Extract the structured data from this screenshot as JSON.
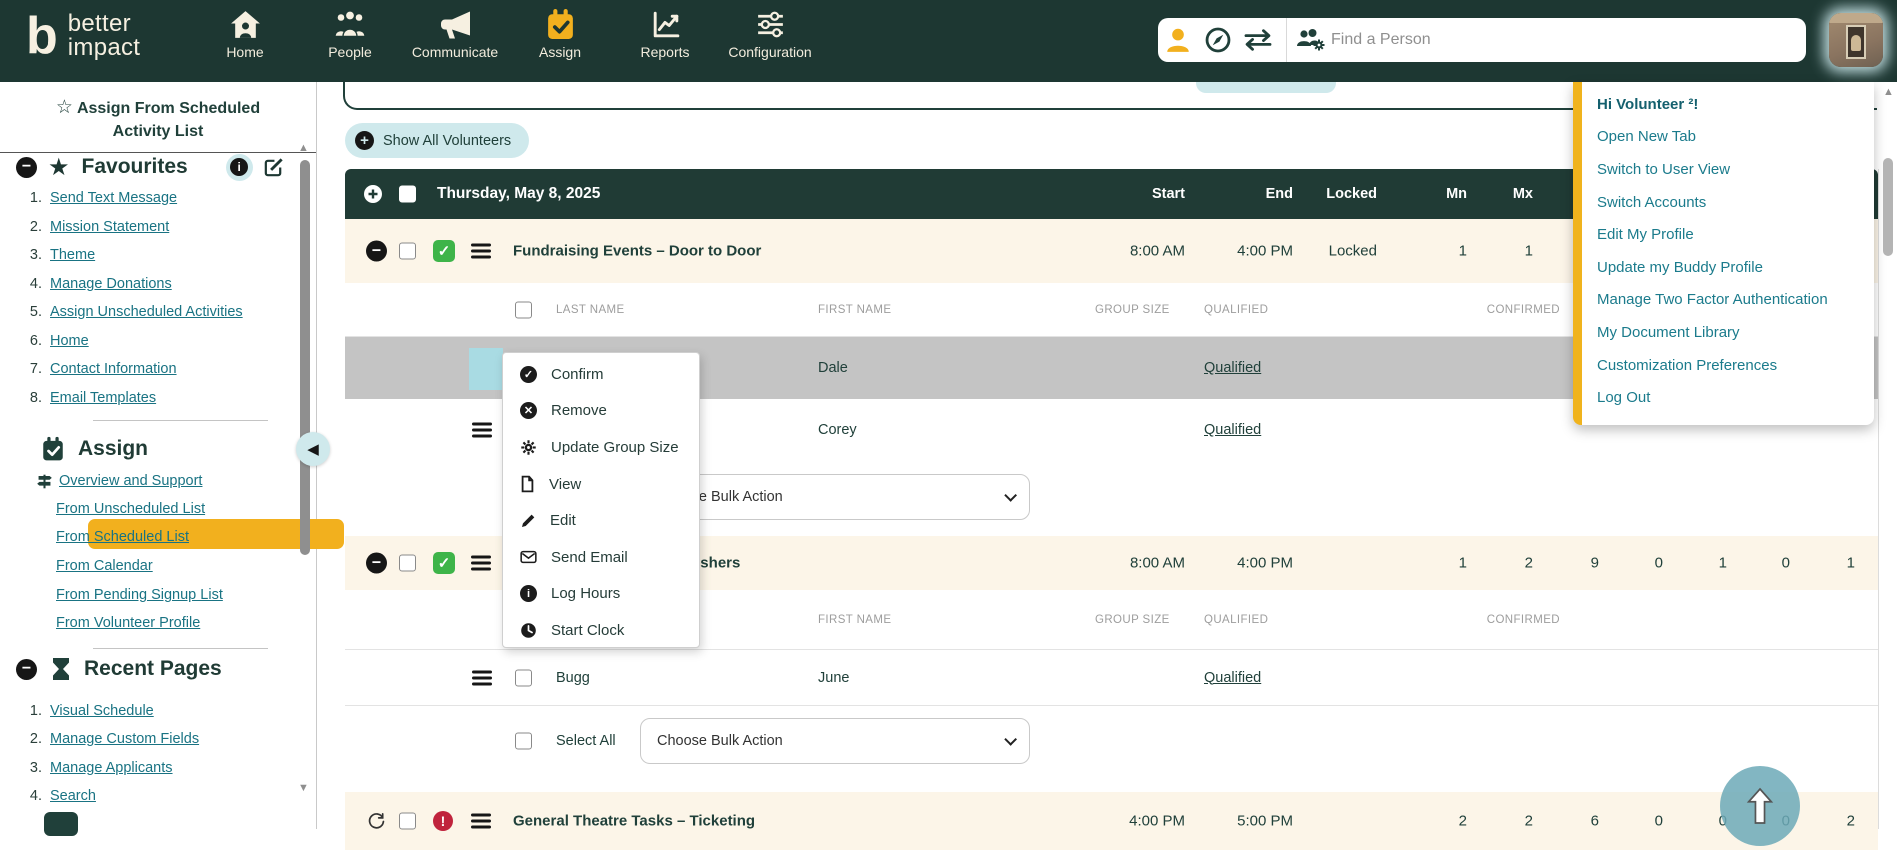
{
  "colors": {
    "nav_bg": "#1d3732",
    "accent_yellow": "#f2b01e",
    "light_teal": "#cfe9ec",
    "link_teal": "#197383",
    "menu_teal": "#1b7b8c",
    "dark_text": "#20403a",
    "row_cream": "#fcf5e8",
    "row_selected_gray": "#c4c4c4",
    "error_red": "#c0233c",
    "success_green": "#3eb449"
  },
  "nav": {
    "items": [
      "Home",
      "People",
      "Communicate",
      "Assign",
      "Reports",
      "Configuration"
    ],
    "active": "Assign",
    "search_placeholder": "Find a Person"
  },
  "user_menu": {
    "greeting": "Hi Volunteer ²!",
    "items": [
      "Open New Tab",
      "Switch to User View",
      "Switch Accounts",
      "Edit My Profile",
      "Update my Buddy Profile",
      "Manage Two Factor Authentication",
      "My Document Library",
      "Customization Preferences",
      "Log Out"
    ]
  },
  "sidebar": {
    "title": "Assign From Scheduled Activity List",
    "favourites": {
      "title": "Favourites",
      "items": [
        {
          "num": "1.",
          "label": "Send Text Message"
        },
        {
          "num": "2.",
          "label": "Mission Statement"
        },
        {
          "num": "3.",
          "label": "Theme"
        },
        {
          "num": "4.",
          "label": "Manage Donations"
        },
        {
          "num": "5.",
          "label": "Assign Unscheduled Activities"
        },
        {
          "num": "6.",
          "label": "Home"
        },
        {
          "num": "7.",
          "label": "Contact Information"
        },
        {
          "num": "8.",
          "label": "Email Templates"
        }
      ]
    },
    "assign": {
      "title": "Assign",
      "links": [
        "Overview and Support",
        "From Unscheduled List",
        "From Scheduled List",
        "From Calendar",
        "From Pending Signup List",
        "From Volunteer Profile"
      ],
      "active": "From Scheduled List"
    },
    "recent": {
      "title": "Recent Pages",
      "items": [
        {
          "num": "1.",
          "label": "Visual Schedule"
        },
        {
          "num": "2.",
          "label": "Manage Custom Fields"
        },
        {
          "num": "3.",
          "label": "Manage Applicants"
        },
        {
          "num": "4.",
          "label": "Search"
        }
      ]
    }
  },
  "main": {
    "show_all_label": "Show All Volunteers",
    "table": {
      "date_title": "Thursday, May 8, 2025",
      "columns": [
        "Start",
        "End",
        "Locked",
        "Mn",
        "Mx"
      ],
      "subcolumns": [
        "LAST NAME",
        "FIRST NAME",
        "GROUP SIZE",
        "QUALIFIED",
        "CONFIRMED"
      ],
      "activities": [
        {
          "name": "Fundraising Events – Door to Door",
          "start": "8:00 AM",
          "end": "4:00 PM",
          "locked": "Locked",
          "mn": "1",
          "mx": "1"
        },
        {
          "name": "General Theatre Tasks – Ushers",
          "start": "8:00 AM",
          "end": "4:00 PM",
          "counts": [
            "1",
            "2",
            "9",
            "0",
            "1",
            "0",
            "1"
          ]
        },
        {
          "name": "General Theatre Tasks – Ticketing",
          "start": "4:00 PM",
          "end": "5:00 PM",
          "counts": [
            "2",
            "2",
            "6",
            "0",
            "0",
            "0",
            "2"
          ]
        }
      ],
      "volunteers": [
        {
          "first": "Dale",
          "qualified": "Qualified"
        },
        {
          "first": "Corey",
          "qualified": "Qualified"
        },
        {
          "last": "Bugg",
          "first": "June",
          "qualified": "Qualified"
        }
      ],
      "bulk": {
        "select_all": "Select All",
        "choose": "Choose Bulk Action"
      }
    }
  },
  "context_menu": {
    "items": [
      "Confirm",
      "Remove",
      "Update Group Size",
      "View",
      "Edit",
      "Send Email",
      "Log Hours",
      "Start Clock"
    ]
  },
  "icons": {
    "nav": [
      "home-icon",
      "people-icon",
      "megaphone-icon",
      "calendar-check-icon",
      "line-chart-icon",
      "sliders-icon"
    ],
    "search": [
      "person-icon",
      "compass-icon",
      "swap-arrows-icon",
      "people-gear-icon"
    ],
    "context": [
      "check-circle-icon",
      "x-circle-icon",
      "gear-icon",
      "page-icon",
      "pencil-icon",
      "envelope-icon",
      "info-circle-icon",
      "clock-icon"
    ]
  }
}
